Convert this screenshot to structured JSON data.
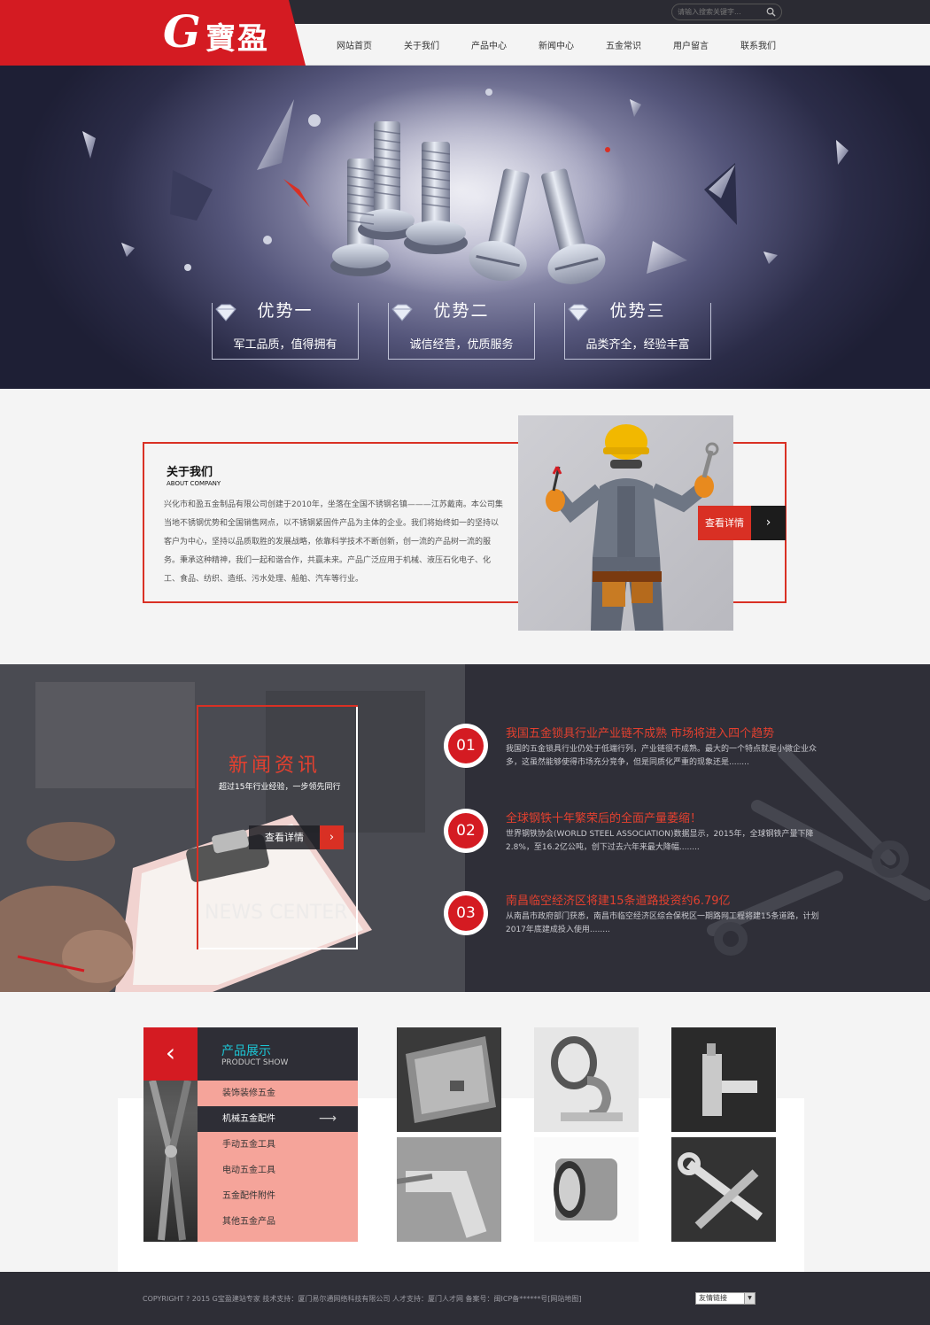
{
  "brand": {
    "logo_letter": "G",
    "logo_name": "寶盈",
    "logo_color": "#d41b22"
  },
  "search": {
    "placeholder": "请输入搜索关键字..."
  },
  "nav": {
    "items": [
      {
        "label": "网站首页"
      },
      {
        "label": "关于我们"
      },
      {
        "label": "产品中心"
      },
      {
        "label": "新闻中心"
      },
      {
        "label": "五金常识"
      },
      {
        "label": "用户留言"
      },
      {
        "label": "联系我们"
      }
    ]
  },
  "hero": {
    "advantages": [
      {
        "title": "优势一",
        "subtitle": "军工品质，值得拥有"
      },
      {
        "title": "优势二",
        "subtitle": "诚信经营，优质服务"
      },
      {
        "title": "优势三",
        "subtitle": "品类齐全，经验丰富"
      }
    ]
  },
  "about": {
    "title": "关于我们",
    "subtitle": "ABOUT COMPANY",
    "text": "兴化市和盈五金制品有限公司创建于2010年，坐落在全国不锈钢名镇———江苏戴南。本公司集当地不锈钢优势和全国销售网点，以不锈钢紧固件产品为主体的企业。我们将始终如一的坚持以客户为中心，坚持以品质取胜的发展战略，依靠科学技术不断创新，创一流的产品树一流的服务。秉承这种精神，我们一起和谐合作，共赢未来。产品广泛应用于机械、液压石化电子、化工、食品、纺织、造纸、污水处理、船舶、汽车等行业。",
    "more_label": "查看详情",
    "accent": "#d93024"
  },
  "news": {
    "title": "新闻资讯",
    "subtitle": "超过15年行业经验，一步领先同行",
    "more_label": "查看详情",
    "watermark": "NEWS CENTER",
    "items": [
      {
        "num": "01",
        "title": "我国五金锁具行业产业链不成熟 市场将进入四个趋势",
        "desc": "我国的五金锁具行业仍处于低端行列，产业链很不成熟。最大的一个特点就是小微企业众多，这虽然能够使得市场充分竞争，但是同质化严重的现象还是........"
      },
      {
        "num": "02",
        "title": "全球钢铁十年繁荣后的全面产量萎缩！",
        "desc": "世界钢铁协会(WORLD STEEL ASSOCIATION)数据显示，2015年，全球钢铁产量下降2.8%，至16.2亿公吨，创下过去六年来最大降幅........"
      },
      {
        "num": "03",
        "title": "南昌临空经济区将建15条道路投资约6.79亿",
        "desc": "从南昌市政府部门获悉，南昌市临空经济区综合保税区一期路网工程将建15条道路，计划2017年底建成投入使用........"
      }
    ]
  },
  "products": {
    "title": "产品展示",
    "subtitle": "PRODUCT SHOW",
    "categories": [
      {
        "label": "装饰装修五金"
      },
      {
        "label": "机械五金配件"
      },
      {
        "label": "手动五金工具"
      },
      {
        "label": "电动五金工具"
      },
      {
        "label": "五金配件附件"
      },
      {
        "label": "其他五金产品"
      }
    ],
    "active_category": "机械五金配件",
    "tiles": [
      "sink",
      "hook",
      "faucet",
      "bracket",
      "bearing",
      "wrenches"
    ],
    "accent_cyan": "#1cc7d6",
    "category_bg": "#f5a49a"
  },
  "footer": {
    "copyright": "COPYRIGHT ? 2015 G宝盈建站专家 技术支持：厦门易尔通网络科技有限公司 人才支持：厦门人才网 备案号：闽ICP备******号[网站地图]",
    "links_label": "友情链接"
  }
}
